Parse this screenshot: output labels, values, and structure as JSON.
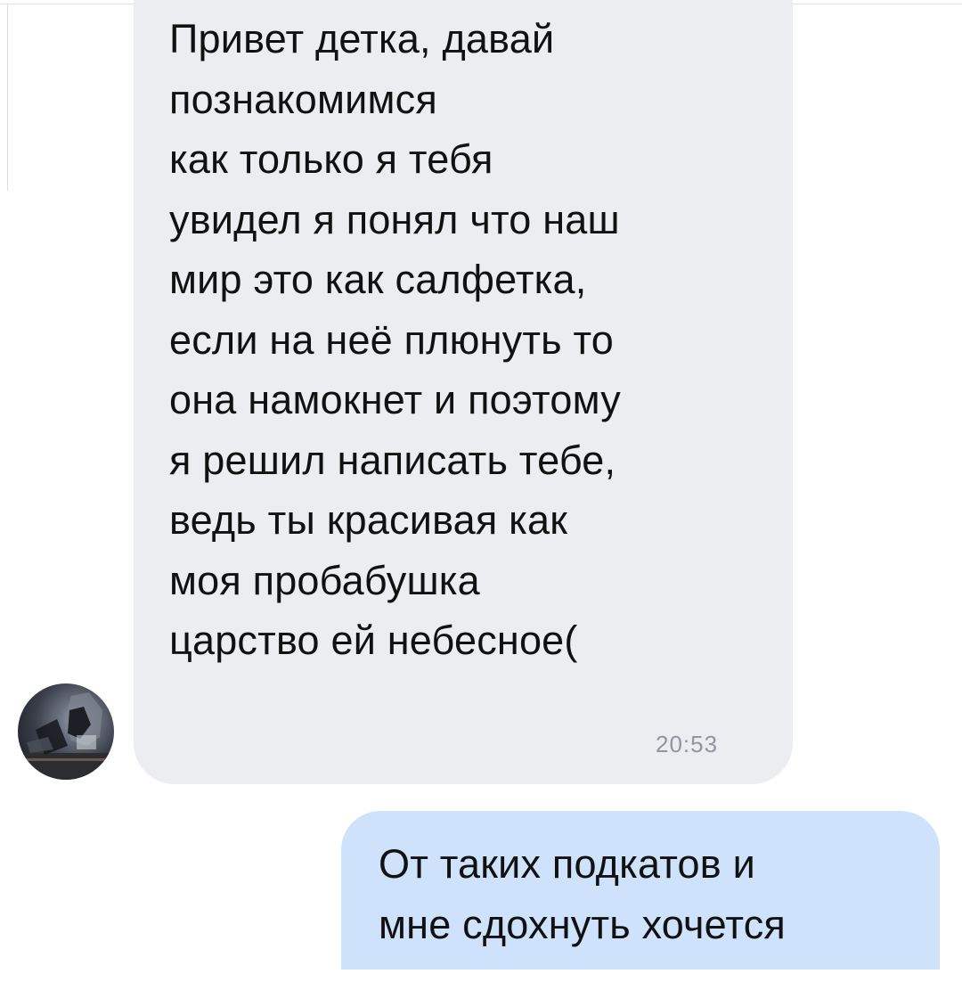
{
  "chat": {
    "incoming_message": {
      "lines": [
        "Привет детка, давай",
        "познакомимся",
        "как только я тебя",
        "увидел я понял что наш",
        "мир это как салфетка,",
        "если на неё плюнуть то",
        "она намокнет и поэтому",
        "я решил написать тебе,",
        "ведь ты красивая как",
        "моя пробабушка",
        "царство ей небесное("
      ],
      "time": "20:53"
    },
    "outgoing_message": {
      "lines": [
        "От таких подкатов и",
        "мне сдохнуть хочется"
      ]
    }
  },
  "colors": {
    "incoming_bubble": "#ebedf0",
    "outgoing_bubble": "#cfe2fb",
    "time_text": "#8f969f"
  },
  "icons": {
    "avatar": "contact-avatar-photo"
  }
}
